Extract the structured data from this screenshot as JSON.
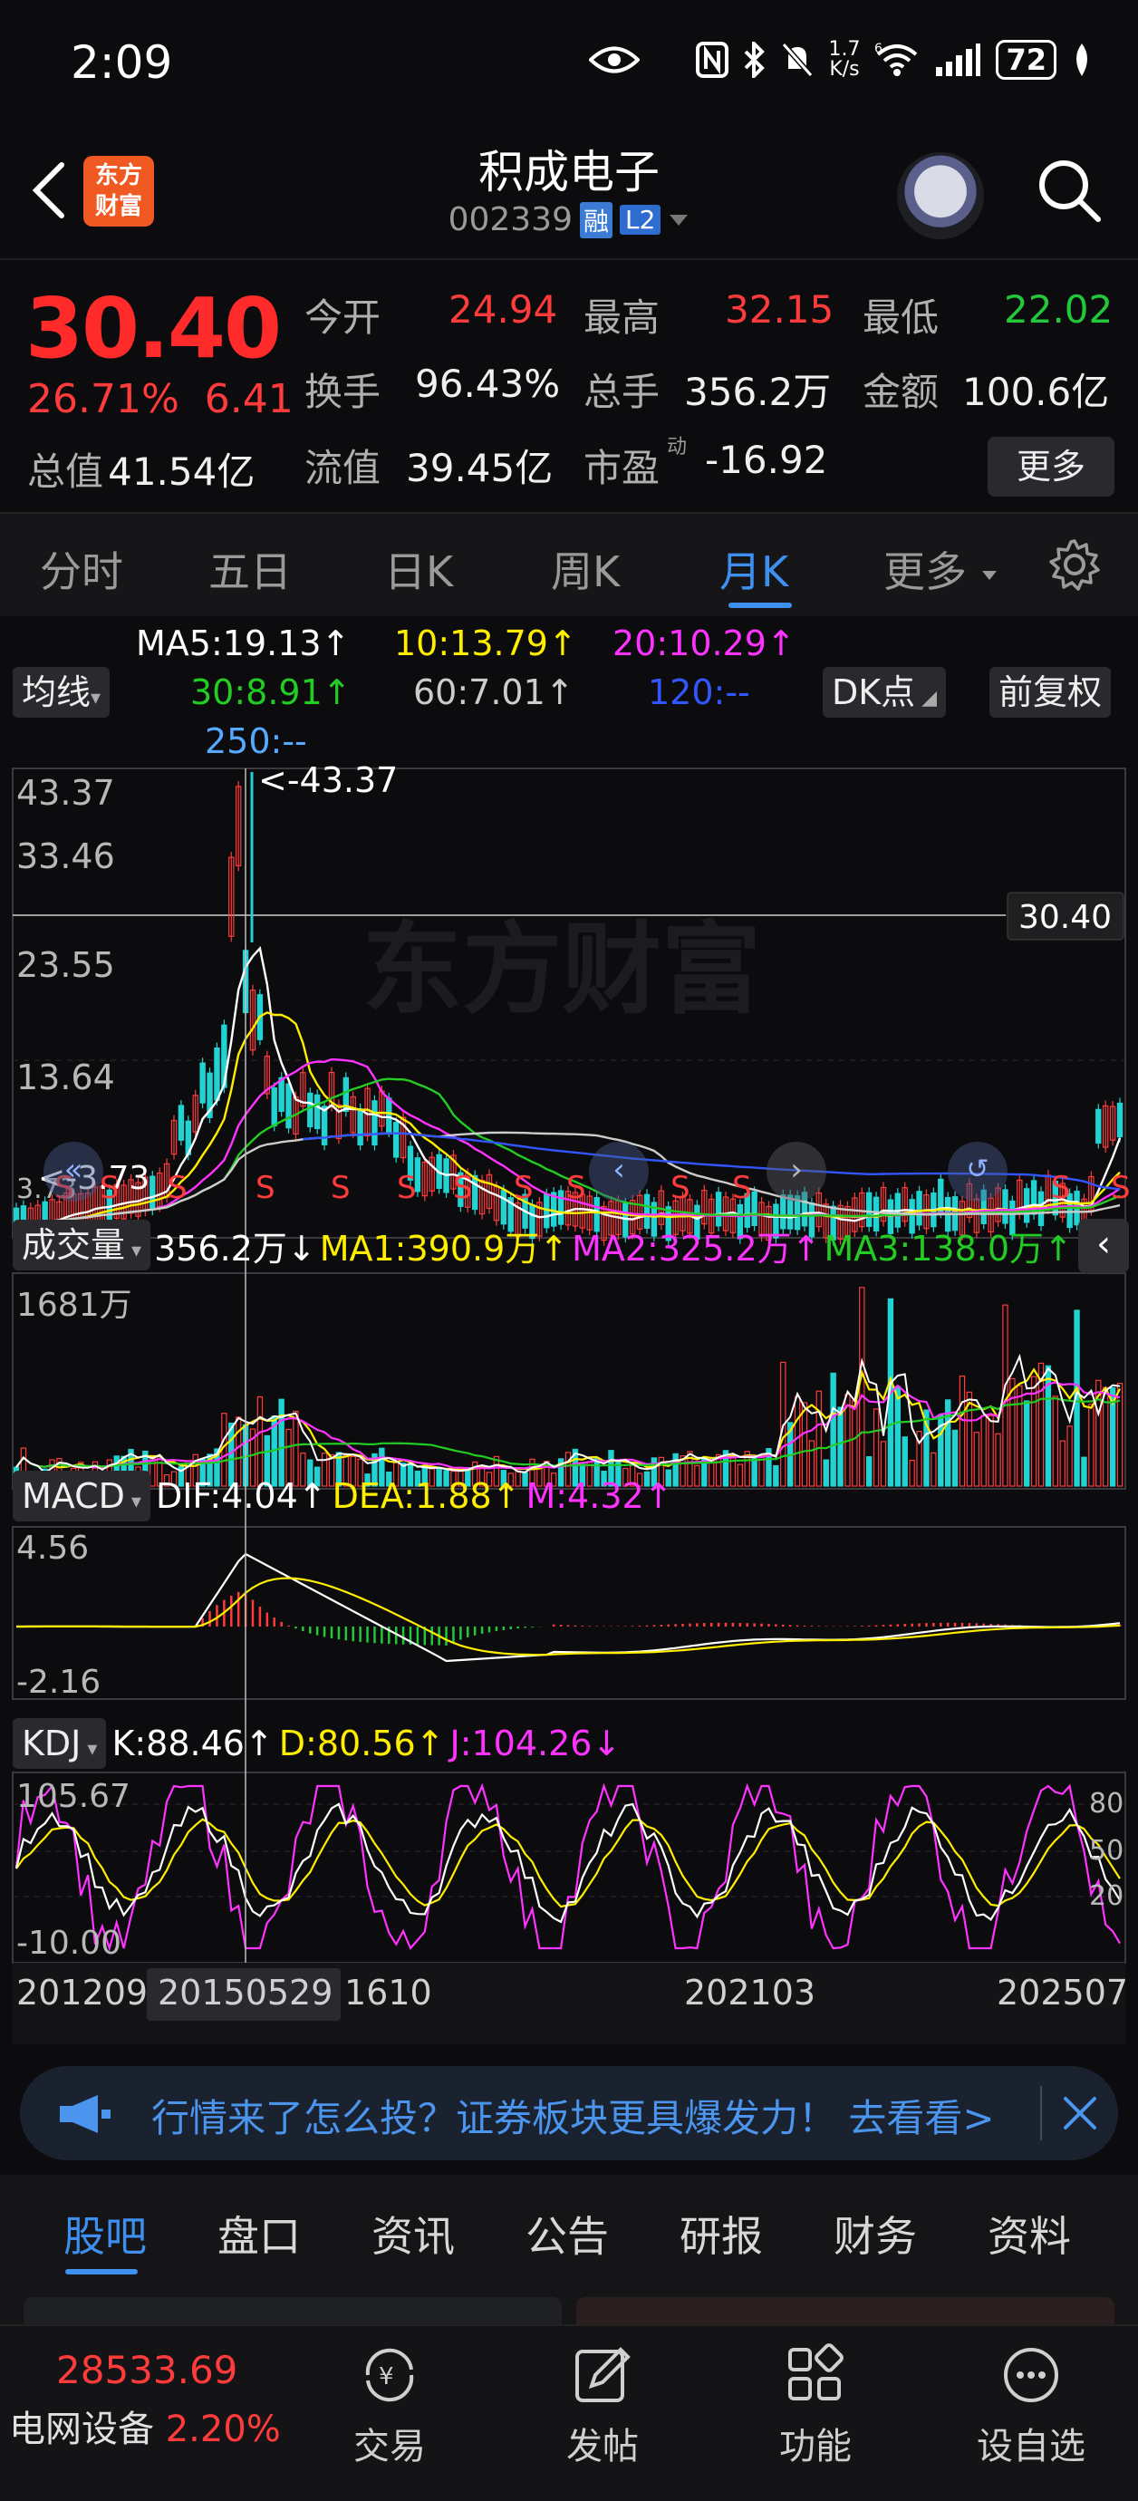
{
  "status_bar": {
    "time": "2:09",
    "net_speed_top": "1.7",
    "net_speed_bottom": "K/s",
    "wifi_label": "6",
    "battery": "72"
  },
  "header": {
    "logo_line1": "东方",
    "logo_line2": "财富",
    "stock_name": "积成电子",
    "stock_code": "002339",
    "tag_rong": "融",
    "tag_l2": "L2"
  },
  "quote": {
    "price": "30.40",
    "change_pct": "26.71%",
    "change_amt": "6.41",
    "open_label": "今开",
    "open": "24.94",
    "high_label": "最高",
    "high": "32.15",
    "low_label": "最低",
    "low": "22.02",
    "turnover_label": "换手",
    "turnover": "96.43%",
    "volume_label": "总手",
    "volume": "356.2万",
    "amount_label": "金额",
    "amount": "100.6亿",
    "mktcap_label": "总值",
    "mktcap": "41.54亿",
    "float_label": "流值",
    "float": "39.45亿",
    "pe_label": "市盈",
    "pe_sup": "动",
    "pe": "-16.92",
    "more_button": "更多"
  },
  "k_tabs": [
    "分时",
    "五日",
    "日K",
    "周K",
    "月K",
    "更多"
  ],
  "ma_legend": {
    "indicator_button": "均线",
    "ma5": "MA5:19.13↑",
    "ma10": "10:13.79↑",
    "ma20": "20:10.29↑",
    "ma30": "30:8.91↑",
    "ma60": "60:7.01↑",
    "ma120": "120:--",
    "ma250": "250:--",
    "dk_button": "DK点",
    "fq_button": "前复权",
    "colors": {
      "ma5": "#ffffff",
      "ma10": "#ffee00",
      "ma20": "#ff33ff",
      "ma30": "#22cc22",
      "ma60": "#cccccc",
      "ma120": "#3355ff",
      "ma250": "#55aaff"
    }
  },
  "price_chart": {
    "y_labels": [
      "43.37",
      "33.46",
      "23.55",
      "13.64",
      "3.73"
    ],
    "max_label": "<-43.37",
    "min_label": "<-3.73",
    "current_price_tag": "30.40",
    "watermark": "东方财富",
    "signal_letter": "S"
  },
  "volume_chart": {
    "indicator_button": "成交量",
    "vol": "356.2万↓",
    "ma1": "MA1:390.9万↑",
    "ma2": "MA2:325.2万↑",
    "ma3": "MA3:138.0万↑",
    "y_label": "1681万"
  },
  "macd_chart": {
    "indicator_button": "MACD",
    "dif": "DIF:4.04↑",
    "dea": "DEA:1.88↑",
    "m": "M:4.32↑",
    "y_top": "4.56",
    "y_bottom": "-2.16"
  },
  "kdj_chart": {
    "indicator_button": "KDJ",
    "k": "K:88.46↑",
    "d": "D:80.56↑",
    "j": "J:104.26↓",
    "y_top": "105.67",
    "y_bottom": "-10.00",
    "levels": [
      "80",
      "50",
      "20"
    ]
  },
  "time_axis": {
    "start": "201209",
    "crosshair": "20150529",
    "after": "1610",
    "mid": "202103",
    "end": "202507"
  },
  "banner": {
    "text": "行情来了怎么投？证券板块更具爆发力！ 去看看>"
  },
  "info_tabs": [
    "股吧",
    "盘口",
    "资讯",
    "公告",
    "研报",
    "财务",
    "资料"
  ],
  "bottom_nav": {
    "index_value": "28533.69",
    "index_name": "电网设备",
    "index_change": "2.20%",
    "items": [
      "交易",
      "发帖",
      "功能",
      "设自选"
    ]
  }
}
